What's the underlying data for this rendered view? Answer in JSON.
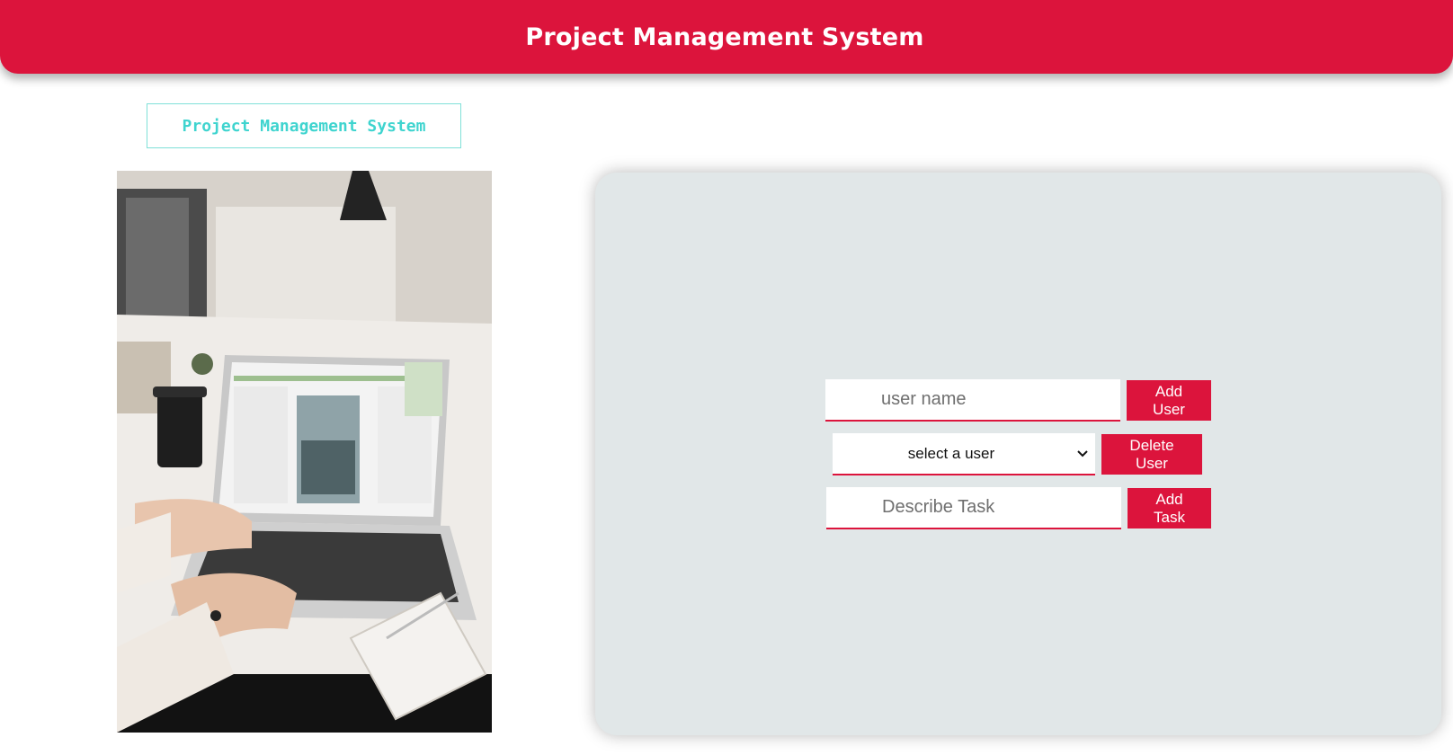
{
  "header": {
    "title": "Project Management System"
  },
  "sidebar": {
    "title": "Project Management System"
  },
  "photo": {
    "description_icon": "laptop-desk-photo"
  },
  "form": {
    "user_name_placeholder": "user name",
    "add_user_label": "Add User",
    "select_user_value": "select a user",
    "delete_user_label": "Delete User",
    "task_placeholder": "Describe Task",
    "add_task_label": "Add Task"
  },
  "colors": {
    "accent": "#dc143c",
    "panel": "#e1e7e8",
    "teal": "#3fd4cf"
  }
}
